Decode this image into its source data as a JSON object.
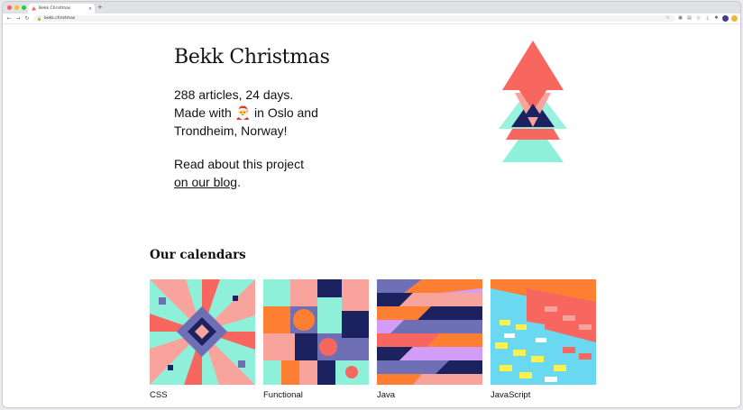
{
  "browser": {
    "tab_title": "Bekk Christmas",
    "tab_close": "×",
    "new_tab": "+",
    "url": "bekk.christmas",
    "nav": {
      "back": "←",
      "forward": "→",
      "reload": "↻"
    }
  },
  "hero": {
    "title": "Bekk Christmas",
    "line1": "288 articles, 24 days.",
    "line2_pre": "Made with ",
    "line2_emoji": "🎅",
    "line2_post": " in Oslo and",
    "line3": "Trondheim, Norway!",
    "about_pre": "Read about this project",
    "about_link": "on our blog",
    "about_post": "."
  },
  "calendars": {
    "heading": "Our calendars",
    "items": [
      {
        "label": "CSS"
      },
      {
        "label": "Functional"
      },
      {
        "label": "Java"
      },
      {
        "label": "JavaScript"
      }
    ]
  },
  "colors": {
    "coral": "#f7665f",
    "mint": "#8ff0da",
    "navy": "#1c2260",
    "orange": "#ff7f32",
    "purple": "#6f6fb6",
    "lavender": "#d39cf6",
    "pink": "#f9a39d",
    "yellow": "#fff04a",
    "sky": "#69d8f0"
  }
}
